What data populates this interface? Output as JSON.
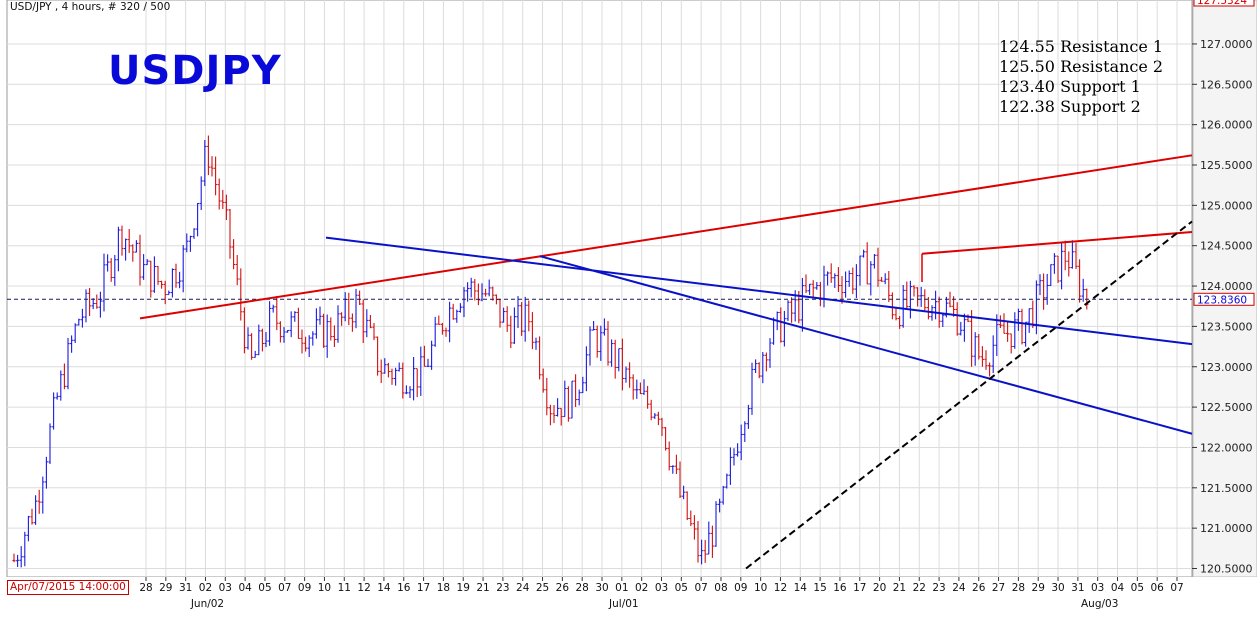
{
  "header": {
    "symbol_info": "USD/JPY , 4 hours, # 320 / 500"
  },
  "annotation": {
    "title": "USDJPY",
    "levels": [
      "124.55 Resistance 1",
      "125.50 Resistance 2",
      "123.40 Support 1",
      "122.38 Support 2"
    ]
  },
  "cursor_date": "Apr/07/2015 14:00:00",
  "current_price": "123.8360",
  "top_price_label": "127.5324",
  "colors": {
    "up_bar": "#1a1ae0",
    "down_bar": "#d01010",
    "resistance_line": "#dd0000",
    "trend_line": "#0a12c8",
    "support_line": "#000000",
    "grid": "#dcdcdc"
  },
  "chart_data": {
    "type": "line",
    "title": "USDJPY",
    "subtitle": "USD/JPY , 4 hours",
    "y_axis": {
      "position": "right",
      "range": [
        120.35,
        127.35
      ],
      "ticks": [
        "120.5000",
        "121.0000",
        "121.5000",
        "122.0000",
        "122.5000",
        "123.0000",
        "123.5000",
        "124.0000",
        "124.5000",
        "125.0000",
        "125.5000",
        "126.0000",
        "126.5000",
        "127.0000"
      ]
    },
    "x_ticks": [
      "28",
      "29",
      "31",
      "02",
      "03",
      "04",
      "05",
      "07",
      "09",
      "10",
      "11",
      "12",
      "14",
      "16",
      "17",
      "18",
      "19",
      "21",
      "23",
      "24",
      "25",
      "26",
      "28",
      "30",
      "01",
      "02",
      "03",
      "05",
      "07",
      "08",
      "09",
      "10",
      "12",
      "14",
      "15",
      "16",
      "17",
      "20",
      "21",
      "22",
      "23",
      "24",
      "26",
      "27",
      "28",
      "29",
      "30",
      "31",
      "03",
      "04",
      "05",
      "06",
      "07"
    ],
    "month_labels": [
      "Jun/02",
      "Jul/01",
      "Aug/03"
    ],
    "price_path": [
      {
        "date": "May/26",
        "price": 120.6
      },
      {
        "date": "May/27",
        "price": 121.3
      },
      {
        "date": "May/28",
        "price": 122.6
      },
      {
        "date": "May/29",
        "price": 123.6
      },
      {
        "date": "May/31",
        "price": 123.9
      },
      {
        "date": "Jun/02",
        "price": 124.7
      },
      {
        "date": "Jun/03",
        "price": 124.2
      },
      {
        "date": "Jun/04",
        "price": 124.0
      },
      {
        "date": "Jun/05",
        "price": 124.4
      },
      {
        "date": "Jun/07",
        "price": 125.7
      },
      {
        "date": "Jun/09",
        "price": 124.6
      },
      {
        "date": "Jun/10",
        "price": 123.0
      },
      {
        "date": "Jun/11",
        "price": 123.6
      },
      {
        "date": "Jun/12",
        "price": 123.5
      },
      {
        "date": "Jun/14",
        "price": 123.4
      },
      {
        "date": "Jun/16",
        "price": 123.5
      },
      {
        "date": "Jun/17",
        "price": 123.8
      },
      {
        "date": "Jun/18",
        "price": 123.0
      },
      {
        "date": "Jun/19",
        "price": 122.9
      },
      {
        "date": "Jun/21",
        "price": 122.9
      },
      {
        "date": "Jun/23",
        "price": 123.6
      },
      {
        "date": "Jun/24",
        "price": 124.0
      },
      {
        "date": "Jun/25",
        "price": 123.9
      },
      {
        "date": "Jun/26",
        "price": 123.5
      },
      {
        "date": "Jun/28",
        "price": 123.6
      },
      {
        "date": "Jun/30",
        "price": 122.5
      },
      {
        "date": "Jul/01",
        "price": 122.6
      },
      {
        "date": "Jul/02",
        "price": 123.4
      },
      {
        "date": "Jul/03",
        "price": 123.1
      },
      {
        "date": "Jul/05",
        "price": 122.6
      },
      {
        "date": "Jul/07",
        "price": 122.5
      },
      {
        "date": "Jul/08",
        "price": 121.4
      },
      {
        "date": "Jul/09",
        "price": 120.6
      },
      {
        "date": "Jul/10",
        "price": 121.3
      },
      {
        "date": "Jul/12",
        "price": 122.5
      },
      {
        "date": "Jul/14",
        "price": 123.3
      },
      {
        "date": "Jul/15",
        "price": 123.6
      },
      {
        "date": "Jul/16",
        "price": 123.9
      },
      {
        "date": "Jul/17",
        "price": 124.1
      },
      {
        "date": "Jul/20",
        "price": 124.1
      },
      {
        "date": "Jul/21",
        "price": 124.3
      },
      {
        "date": "Jul/22",
        "price": 123.7
      },
      {
        "date": "Jul/23",
        "price": 123.8
      },
      {
        "date": "Jul/24",
        "price": 123.8
      },
      {
        "date": "Jul/26",
        "price": 123.6
      },
      {
        "date": "Jul/27",
        "price": 123.1
      },
      {
        "date": "Jul/28",
        "price": 123.4
      },
      {
        "date": "Jul/29",
        "price": 123.5
      },
      {
        "date": "Jul/30",
        "price": 124.0
      },
      {
        "date": "Jul/31",
        "price": 124.4
      },
      {
        "date": "Aug/03",
        "price": 123.8
      }
    ]
  }
}
